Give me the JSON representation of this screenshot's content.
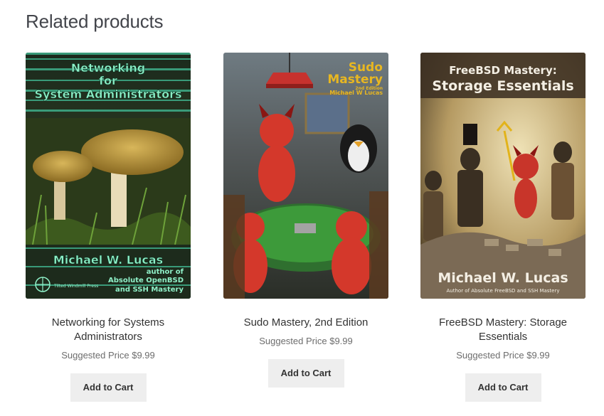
{
  "section": {
    "title": "Related products"
  },
  "products": [
    {
      "name": "Networking for Systems Administrators",
      "price": "Suggested Price $9.99",
      "button": "Add to Cart",
      "cover": {
        "title_lines": [
          "Networking",
          "for",
          "System Administrators"
        ],
        "author": "Michael W. Lucas",
        "tagline_lines": [
          "author of",
          "Absolute OpenBSD",
          "and SSH Mastery"
        ],
        "publisher": "Tilted Windmill Press"
      }
    },
    {
      "name": "Sudo Mastery, 2nd Edition",
      "price": "Suggested Price $9.99",
      "button": "Add to Cart",
      "cover": {
        "title_lines": [
          "Sudo",
          "Mastery"
        ],
        "edition": "2nd Edition",
        "author": "Michael W Lucas"
      }
    },
    {
      "name": "FreeBSD Mastery: Storage Essentials",
      "price": "Suggested Price $9.99",
      "button": "Add to Cart",
      "cover": {
        "title_lines": [
          "FreeBSD Mastery:",
          "Storage Essentials"
        ],
        "author": "Michael W. Lucas",
        "tagline": "Author of Absolute FreeBSD and SSH Mastery"
      }
    }
  ],
  "colors": {
    "title_text": "#43454b",
    "price_text": "#6d6d6d",
    "button_bg": "#eeeeee",
    "button_text": "#333333"
  }
}
